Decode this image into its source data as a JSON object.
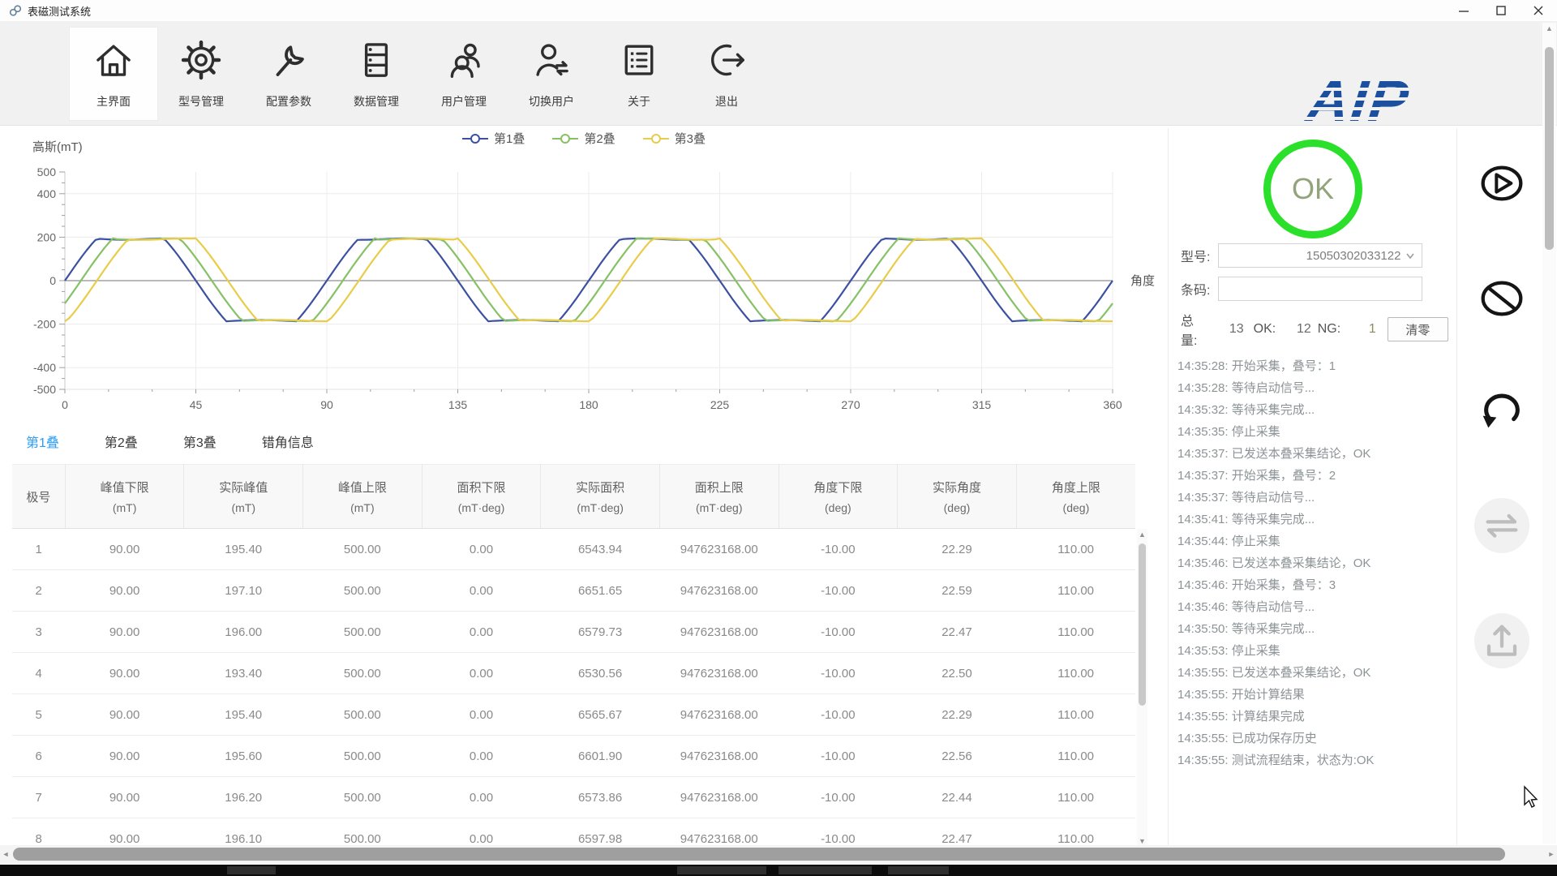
{
  "window": {
    "title": "表磁测试系统"
  },
  "toolbar": {
    "logo_text": "AIP",
    "items": [
      {
        "label": "主界面",
        "icon": "home-icon",
        "active": true
      },
      {
        "label": "型号管理",
        "icon": "gear-icon",
        "active": false
      },
      {
        "label": "配置参数",
        "icon": "wrench-icon",
        "active": false
      },
      {
        "label": "数据管理",
        "icon": "database-icon",
        "active": false
      },
      {
        "label": "用户管理",
        "icon": "users-icon",
        "active": false
      },
      {
        "label": "切换用户",
        "icon": "switch-user-icon",
        "active": false
      },
      {
        "label": "关于",
        "icon": "about-icon",
        "active": false
      },
      {
        "label": "退出",
        "icon": "exit-icon",
        "active": false
      }
    ]
  },
  "chart_data": {
    "type": "line",
    "title": "",
    "ylabel": "高斯(mT)",
    "xlabel": "角度",
    "xlim": [
      0,
      360
    ],
    "ylim": [
      -500,
      500
    ],
    "x_ticks": [
      0,
      45,
      90,
      135,
      180,
      225,
      270,
      315,
      360
    ],
    "y_ticks": [
      500,
      400,
      200,
      0,
      -200,
      -400,
      -500
    ],
    "grid": true,
    "legend_position": "top-center",
    "series": [
      {
        "name": "第1叠",
        "color": "#3c50a2",
        "phase_deg": 0
      },
      {
        "name": "第2叠",
        "color": "#86c166",
        "phase_deg": 5.5
      },
      {
        "name": "第3叠",
        "color": "#e8cc4a",
        "phase_deg": 11
      }
    ],
    "waveform": {
      "shape": "clipped-sine",
      "period_deg": 90,
      "base_amplitude": 280,
      "clip_max": 195,
      "clip_min": -188,
      "step_deg": 1.5
    }
  },
  "tabs": [
    {
      "label": "第1叠",
      "active": true
    },
    {
      "label": "第2叠",
      "active": false
    },
    {
      "label": "第3叠",
      "active": false
    },
    {
      "label": "错角信息",
      "active": false
    }
  ],
  "table": {
    "columns": [
      {
        "name": "极号",
        "unit": ""
      },
      {
        "name": "峰值下限",
        "unit": "(mT)"
      },
      {
        "name": "实际峰值",
        "unit": "(mT)"
      },
      {
        "name": "峰值上限",
        "unit": "(mT)"
      },
      {
        "name": "面积下限",
        "unit": "(mT·deg)"
      },
      {
        "name": "实际面积",
        "unit": "(mT·deg)"
      },
      {
        "name": "面积上限",
        "unit": "(mT·deg)"
      },
      {
        "name": "角度下限",
        "unit": "(deg)"
      },
      {
        "name": "实际角度",
        "unit": "(deg)"
      },
      {
        "name": "角度上限",
        "unit": "(deg)"
      }
    ],
    "rows": [
      [
        "1",
        "90.00",
        "195.40",
        "500.00",
        "0.00",
        "6543.94",
        "947623168.00",
        "-10.00",
        "22.29",
        "110.00"
      ],
      [
        "2",
        "90.00",
        "197.10",
        "500.00",
        "0.00",
        "6651.65",
        "947623168.00",
        "-10.00",
        "22.59",
        "110.00"
      ],
      [
        "3",
        "90.00",
        "196.00",
        "500.00",
        "0.00",
        "6579.73",
        "947623168.00",
        "-10.00",
        "22.47",
        "110.00"
      ],
      [
        "4",
        "90.00",
        "193.40",
        "500.00",
        "0.00",
        "6530.56",
        "947623168.00",
        "-10.00",
        "22.50",
        "110.00"
      ],
      [
        "5",
        "90.00",
        "195.40",
        "500.00",
        "0.00",
        "6565.67",
        "947623168.00",
        "-10.00",
        "22.29",
        "110.00"
      ],
      [
        "6",
        "90.00",
        "195.60",
        "500.00",
        "0.00",
        "6601.90",
        "947623168.00",
        "-10.00",
        "22.56",
        "110.00"
      ],
      [
        "7",
        "90.00",
        "196.20",
        "500.00",
        "0.00",
        "6573.86",
        "947623168.00",
        "-10.00",
        "22.44",
        "110.00"
      ],
      [
        "8",
        "90.00",
        "196.10",
        "500.00",
        "0.00",
        "6597.98",
        "947623168.00",
        "-10.00",
        "22.47",
        "110.00"
      ]
    ]
  },
  "status": {
    "result": "OK",
    "model_label": "型号:",
    "model_value": "15050302033122",
    "barcode_label": "条码:",
    "barcode_value": "",
    "total_label": "总量:",
    "total_value": "13",
    "ok_label": "OK:",
    "ok_value": "12",
    "ng_label": "NG:",
    "ng_value": "1",
    "clear_label": "清零"
  },
  "log": [
    "14:35:28: 开始采集，叠号：1",
    "14:35:28: 等待启动信号...",
    "14:35:32: 等待采集完成...",
    "14:35:35: 停止采集",
    "14:35:37: 已发送本叠采集结论，OK",
    "14:35:37: 开始采集，叠号：2",
    "14:35:37: 等待启动信号...",
    "14:35:41: 等待采集完成...",
    "14:35:44: 停止采集",
    "14:35:46: 已发送本叠采集结论，OK",
    "14:35:46: 开始采集，叠号：3",
    "14:35:46: 等待启动信号...",
    "14:35:50: 等待采集完成...",
    "14:35:53: 停止采集",
    "14:35:55: 已发送本叠采集结论，OK",
    "14:35:55: 开始计算结果",
    "14:35:55: 计算结果完成",
    "14:35:55: 已成功保存历史",
    "14:35:55: 测试流程结束，状态为:OK"
  ],
  "side_actions": [
    {
      "name": "start",
      "icon": "play-circle-icon",
      "enabled": true
    },
    {
      "name": "stop",
      "icon": "ban-icon",
      "enabled": true
    },
    {
      "name": "repeat",
      "icon": "rotate-icon",
      "enabled": true
    },
    {
      "name": "transfer",
      "icon": "transfer-icon",
      "enabled": false
    },
    {
      "name": "upload",
      "icon": "upload-icon",
      "enabled": false
    }
  ],
  "colors": {
    "accent_blue": "#2b9cf2",
    "ok_green": "#2be02b",
    "logo_blue": "#1d4f9f"
  }
}
